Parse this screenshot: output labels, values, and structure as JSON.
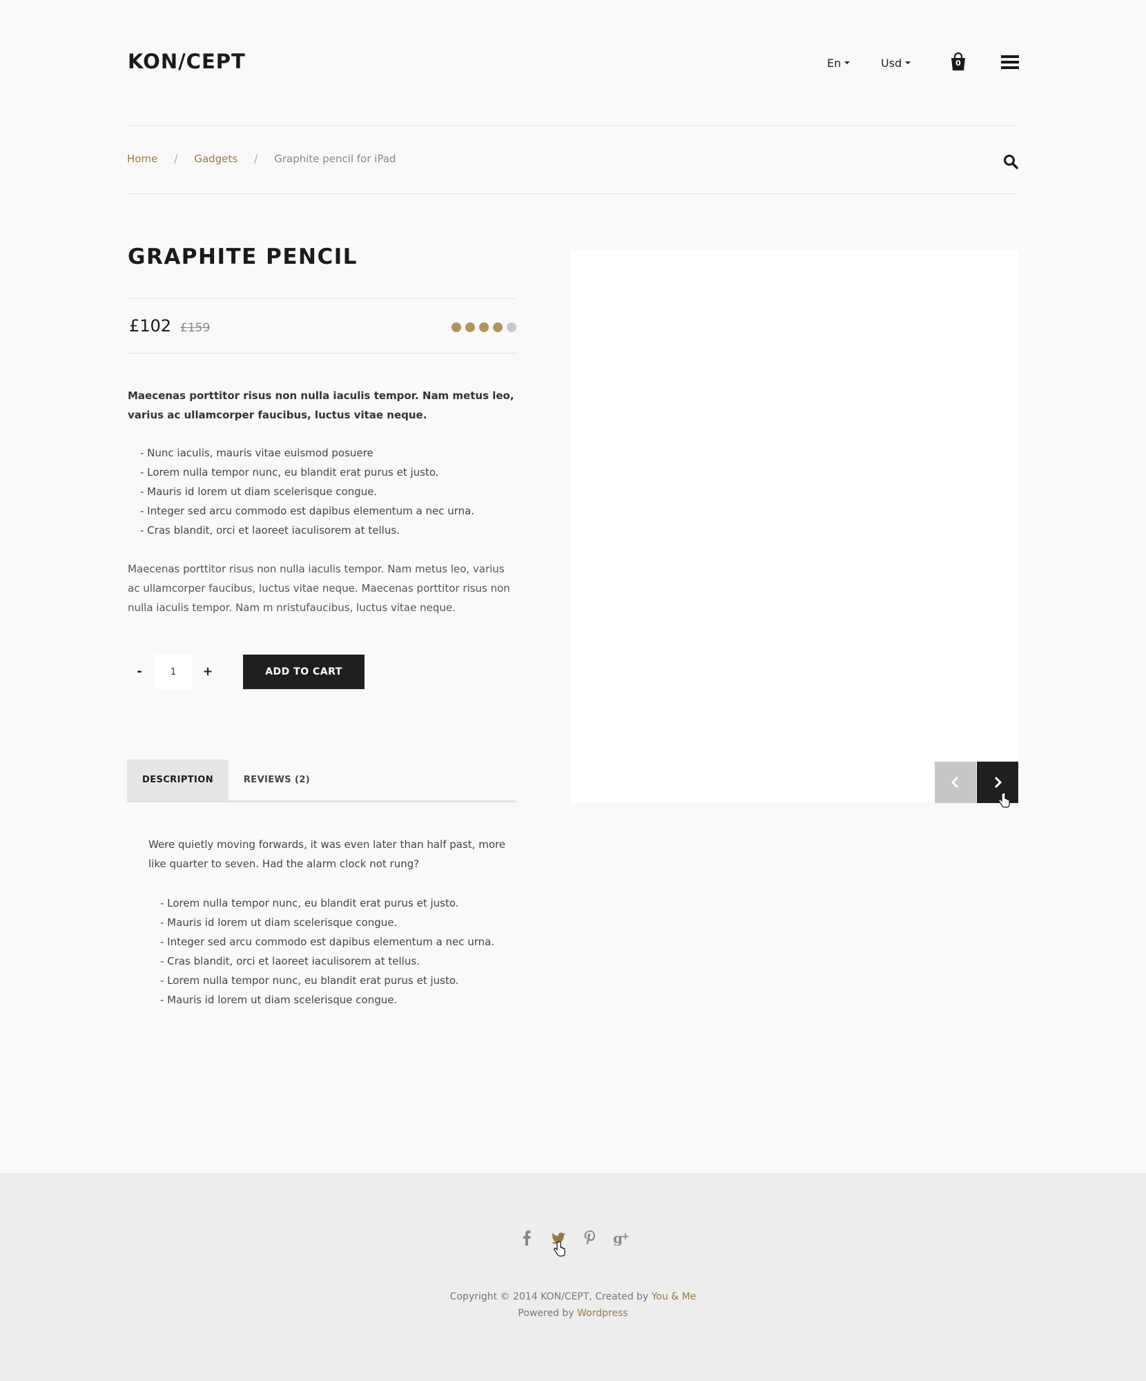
{
  "header": {
    "logo": "KON/CEPT",
    "language": "En",
    "currency": "Usd",
    "cart_count": "0"
  },
  "breadcrumb": {
    "home": "Home",
    "category": "Gadgets",
    "current": "Graphite pencil for iPad",
    "separator": "/"
  },
  "product": {
    "title": "GRAPHITE PENCIL",
    "price": "£102",
    "old_price": "£159",
    "rating": 4,
    "rating_max": 5,
    "rating_color": "#b39458",
    "lead": "Maecenas porttitor risus non nulla iaculis tempor. Nam metus leo, varius ac ullamcorper faucibus, luctus vitae neque.",
    "bullets": [
      "- Nunc iaculis, mauris vitae euismod posuere",
      "- Lorem nulla tempor nunc, eu blandit erat purus et justo.",
      "- Mauris id lorem ut diam scelerisque congue.",
      "- Integer sed arcu commodo est dapibus elementum a nec urna.",
      "- Cras blandit, orci et laoreet iaculisorem at tellus."
    ],
    "paragraph": "Maecenas porttitor risus non nulla iaculis tempor. Nam metus leo, varius ac ullamcorper faucibus, luctus vitae neque. Maecenas porttitor risus non nulla iaculis tempor. Nam m nristufaucibus, luctus vitae neque.",
    "qty_minus": "-",
    "qty_value": "1",
    "qty_plus": "+",
    "add_to_cart": "ADD TO CART"
  },
  "tabs": {
    "items": [
      {
        "label": "DESCRIPTION",
        "active": true
      },
      {
        "label": "REVIEWS (2)",
        "active": false
      }
    ],
    "description_intro": "Were quietly moving forwards, it was even later than half past, more like quarter to seven. Had the alarm clock not rung?",
    "description_bullets": [
      "- Lorem nulla tempor nunc, eu blandit erat purus et justo.",
      "- Mauris id lorem ut diam scelerisque congue.",
      "- Integer sed arcu commodo est dapibus elementum a nec urna.",
      "- Cras blandit, orci et laoreet iaculisorem at tellus.",
      "- Lorem nulla tempor nunc, eu blandit erat purus et justo.",
      "- Mauris id lorem ut diam scelerisque congue."
    ]
  },
  "footer": {
    "social_icons": [
      "facebook-icon",
      "twitter-icon",
      "pinterest-icon",
      "google-plus-icon"
    ],
    "copyright_prefix": "Copyright © 2014 KON/CEPT, Created by",
    "creator_link": "You & Me",
    "powered_prefix": "Powered by",
    "powered_link": "Wordpress"
  },
  "colors": {
    "accent": "#9a7a41",
    "dark": "#1f1f1f",
    "background": "#f9f9f9",
    "footer_bg": "#ededed"
  }
}
